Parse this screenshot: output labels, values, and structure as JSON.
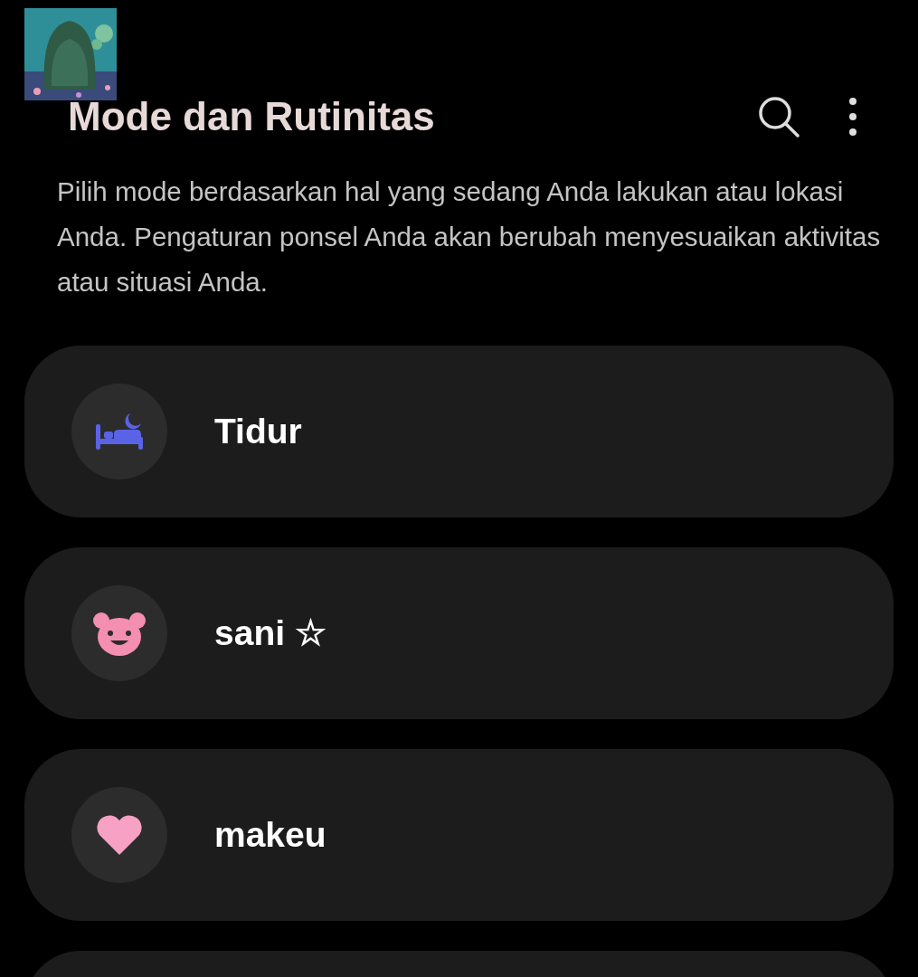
{
  "header": {
    "title": "Mode dan Rutinitas"
  },
  "description": "Pilih mode berdasarkan hal yang sedang Anda lakukan atau lokasi Anda. Pengaturan ponsel Anda akan berubah menyesuaikan aktivitas atau situasi Anda.",
  "modes": [
    {
      "label": "Tidur",
      "color": "#5a63e6"
    },
    {
      "label": "sani ☆",
      "color": "#f48fb1"
    },
    {
      "label": "makeu",
      "color": "#f7a1c4"
    }
  ]
}
